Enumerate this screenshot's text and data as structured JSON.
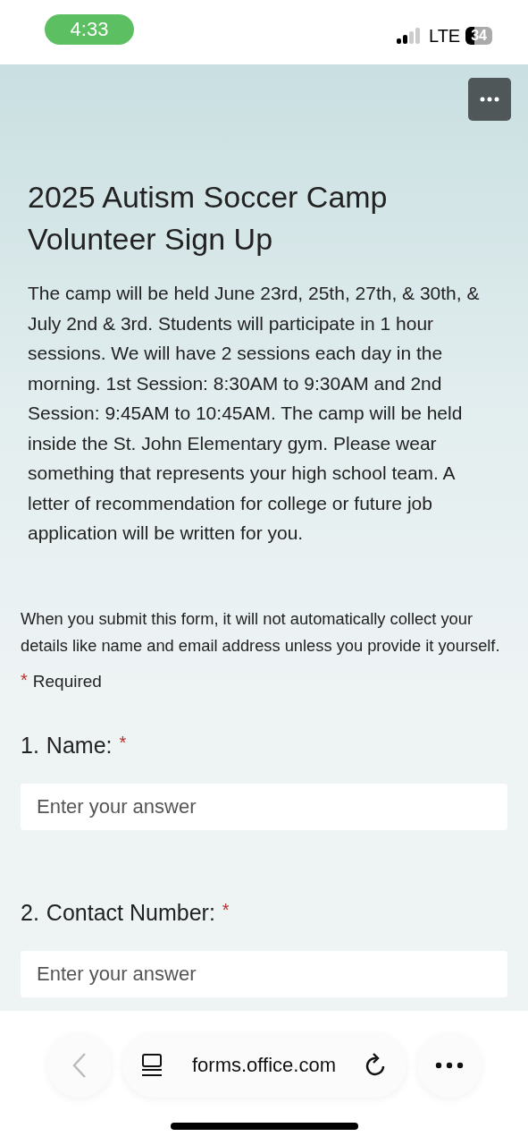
{
  "status_bar": {
    "time": "4:33",
    "network": "LTE",
    "battery": "34"
  },
  "form": {
    "title": "2025 Autism Soccer Camp Volunteer Sign Up",
    "description": "The camp will be held June 23rd, 25th, 27th, & 30th, & July 2nd & 3rd. Students will participate in 1 hour sessions. We will have 2 sessions each day in the morning. 1st Session: 8:30AM to 9:30AM and 2nd Session: 9:45AM to 10:45AM. The camp will be held inside the St. John Elementary gym. Please wear something that represents your high school team. A letter of recommendation for college or future job application will be written for you.",
    "notice": "When you submit this form, it will not automatically collect your details like name and email address unless you provide it yourself.",
    "required_legend": {
      "mark": "*",
      "label": "Required"
    },
    "questions": [
      {
        "number": "1.",
        "label": "Name:",
        "required": true,
        "mark": "*",
        "placeholder": "Enter your answer"
      },
      {
        "number": "2.",
        "label": "Contact Number:",
        "required": true,
        "mark": "*",
        "placeholder": "Enter your answer"
      }
    ]
  },
  "browser_bar": {
    "url": "forms.office.com"
  }
}
